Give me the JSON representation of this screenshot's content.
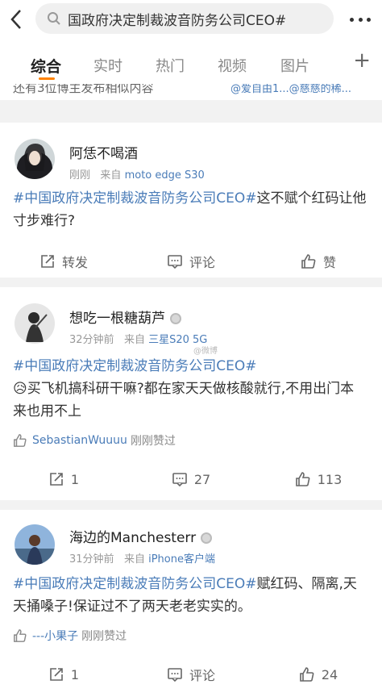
{
  "search": {
    "query": "国政府决定制裁波音防务公司CEO#"
  },
  "tabs": [
    {
      "label": "综合",
      "active": true
    },
    {
      "label": "实时"
    },
    {
      "label": "热门"
    },
    {
      "label": "视频"
    },
    {
      "label": "图片"
    }
  ],
  "peek": {
    "left": "还有3位博主发布相似内容",
    "right": "@爱自由1...@慈慈的稀..."
  },
  "posts": [
    {
      "user": "阿恁不喝酒",
      "time": "刚刚",
      "from_label": "来自",
      "source": "moto edge S30",
      "hashtag": "#中国政府决定制裁波音防务公司CEO#",
      "text": "这不赋个红码让他寸步难行?",
      "repost_label": "转发",
      "comment_label": "评论",
      "like_label": "赞"
    },
    {
      "user": "想吃一根糖葫芦",
      "time": "32分钟前",
      "from_label": "来自",
      "source": "三星S20 5G",
      "watermark": "@微博",
      "hashtag": "#中国政府决定制裁波音防务公司CEO#",
      "text": "买飞机搞科研干嘛?都在家天天做核酸就行,不用出门本来也用不上",
      "liked_by": "SebastianWuuuu",
      "liked_suffix": "刚刚赞过",
      "reposts": "1",
      "comments": "27",
      "likes": "113"
    },
    {
      "user": "海边的Manchesterr",
      "time": "31分钟前",
      "from_label": "来自",
      "source": "iPhone客户端",
      "hashtag": "#中国政府决定制裁波音防务公司CEO#",
      "text": "赋红码、隔离,天天捅嗓子!保证过不了两天老老实实的。",
      "liked_by": "---小果子",
      "liked_suffix": "刚刚赞过",
      "reposts": "1",
      "comment_label": "评论",
      "likes": "24"
    }
  ],
  "colors": {
    "accent": "#ff8200",
    "link": "#4a7cb8"
  }
}
